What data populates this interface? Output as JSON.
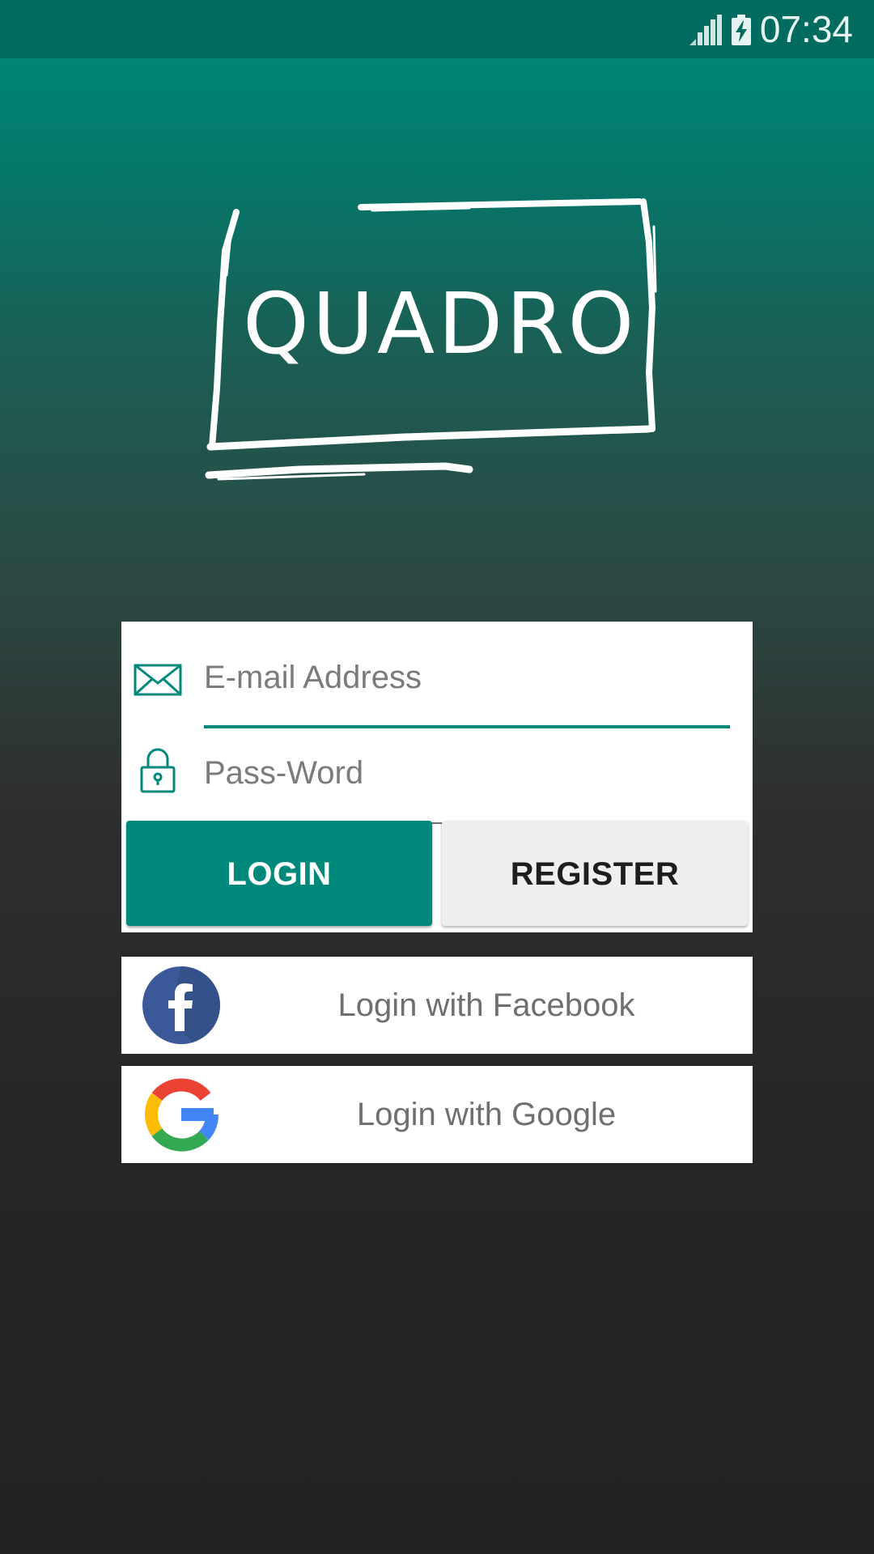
{
  "status_bar": {
    "time": "07:34",
    "signal_icon": "signal-icon",
    "battery_icon": "battery-charging-icon"
  },
  "logo": {
    "text": "QUADRO"
  },
  "login_form": {
    "email": {
      "placeholder": "E-mail Address",
      "value": "",
      "icon": "envelope-icon"
    },
    "password": {
      "placeholder": "Pass-Word",
      "value": "",
      "icon": "lock-icon"
    },
    "login_label": "LOGIN",
    "register_label": "REGISTER"
  },
  "social": {
    "facebook_label": "Login with Facebook",
    "google_label": "Login with Google",
    "facebook_icon": "facebook-icon",
    "google_icon": "google-icon"
  },
  "colors": {
    "accent": "#00897b",
    "status_bar": "#006b5e",
    "facebook": "#3b5998"
  }
}
